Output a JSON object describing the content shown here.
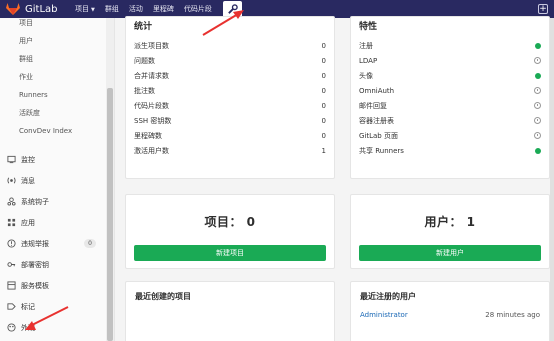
{
  "navbar": {
    "brand": "GitLab",
    "links": [
      "项目",
      "群组",
      "活动",
      "里程碑",
      "代码片段"
    ],
    "plus": "+"
  },
  "sidebar": {
    "sub_items": [
      "项目",
      "用户",
      "群组",
      "作业",
      "Runners",
      "活跃度",
      "ConvDev Index"
    ],
    "items": [
      {
        "label": "监控",
        "icon": "monitor-icon"
      },
      {
        "label": "消息",
        "icon": "broadcast-icon"
      },
      {
        "label": "系统钩子",
        "icon": "hook-icon"
      },
      {
        "label": "应用",
        "icon": "grid-icon"
      },
      {
        "label": "违规举报",
        "icon": "alert-icon",
        "badge": "0"
      },
      {
        "label": "部署密钥",
        "icon": "key-icon"
      },
      {
        "label": "服务模板",
        "icon": "template-icon"
      },
      {
        "label": "标记",
        "icon": "label-icon"
      },
      {
        "label": "外观",
        "icon": "palette-icon"
      }
    ]
  },
  "stats": {
    "title": "统计",
    "rows": [
      {
        "label": "派生项目数",
        "value": "0"
      },
      {
        "label": "问题数",
        "value": "0"
      },
      {
        "label": "合并请求数",
        "value": "0"
      },
      {
        "label": "批注数",
        "value": "0"
      },
      {
        "label": "代码片段数",
        "value": "0"
      },
      {
        "label": "SSH 密钥数",
        "value": "0"
      },
      {
        "label": "里程碑数",
        "value": "0"
      },
      {
        "label": "激活用户数",
        "value": "1"
      }
    ]
  },
  "features": {
    "title": "特性",
    "rows": [
      {
        "label": "注册",
        "state": "on"
      },
      {
        "label": "LDAP",
        "state": "off"
      },
      {
        "label": "头像",
        "state": "on"
      },
      {
        "label": "OmniAuth",
        "state": "off"
      },
      {
        "label": "邮件回复",
        "state": "off"
      },
      {
        "label": "容器注册表",
        "state": "off"
      },
      {
        "label": "GitLab 页面",
        "state": "off"
      },
      {
        "label": "共享 Runners",
        "state": "on"
      }
    ]
  },
  "projects_card": {
    "count_text": "项目： 0",
    "button": "新建项目"
  },
  "users_card": {
    "count_text": "用户： 1",
    "button": "新建用户"
  },
  "latest_projects": {
    "title": "最近创建的项目"
  },
  "latest_users": {
    "title": "最近注册的用户",
    "user": "Administrator",
    "time": "28 minutes ago"
  },
  "colors": {
    "navbar": "#292961",
    "green": "#1aaa55",
    "link": "#1b69b6",
    "annotation": "#e8312f"
  }
}
